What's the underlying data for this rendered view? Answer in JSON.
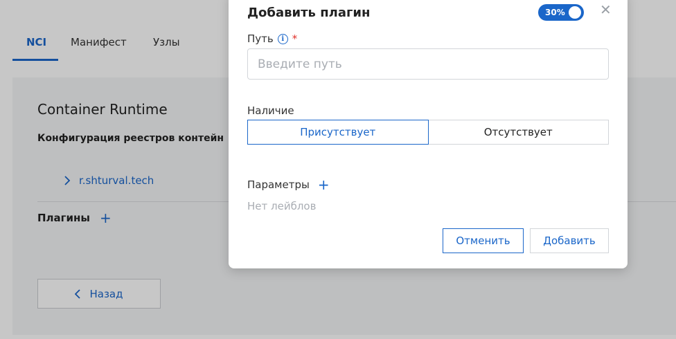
{
  "tabs": [
    {
      "label": "NCI",
      "active": true
    },
    {
      "label": "Манифест",
      "active": false
    },
    {
      "label": "Узлы",
      "active": false
    }
  ],
  "card": {
    "title": "Container Runtime",
    "subtitle": "Конфигурация реестров контейн",
    "registry": "r.shturval.tech",
    "plugins_label": "Плагины",
    "back_label": "Назад"
  },
  "modal": {
    "title": "Добавить плагин",
    "toggle_label": "30%",
    "path_label": "Путь",
    "required_mark": "*",
    "path_placeholder": "Введите путь",
    "path_value": "",
    "availability_label": "Наличие",
    "availability_options": [
      "Присутствует",
      "Отсутствует"
    ],
    "availability_selected": "Присутствует",
    "params_label": "Параметры",
    "params_empty": "Нет лейблов",
    "cancel_label": "Отменить",
    "add_label": "Добавить"
  },
  "colors": {
    "accent": "#1a66c9",
    "required": "#e0312a"
  }
}
